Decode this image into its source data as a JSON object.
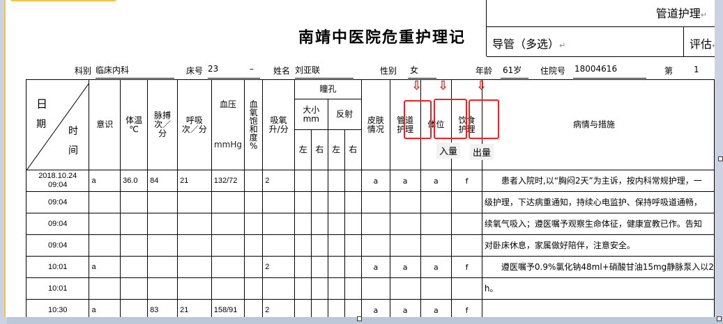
{
  "title": "南靖中医院危重护理记",
  "info": {
    "dept_label": "科别",
    "dept": "临床内科",
    "bed_label": "床号",
    "bed": "23",
    "bed_dash": "–",
    "name_label": "姓名",
    "name": "刘亚联",
    "sex_label": "性别",
    "sex": "女",
    "age_label": "年龄",
    "age": "61岁",
    "adm_label": "住院号",
    "adm": "18004616",
    "page_label": "第",
    "page": "1"
  },
  "headers": {
    "date": "日",
    "date2": "期",
    "time": "时",
    "time2": "间",
    "consc": "意识",
    "temp": "体温\n℃",
    "pulse": "脉搏\n次／\n分",
    "resp": "呼吸\n次／分",
    "bp": "血压",
    "bp_unit": "mmHg",
    "spo2": "血\n氧\n饱\n和\n度\n%",
    "oxy": "吸氧\n升/分",
    "pupil": "瞳孔",
    "size": "大小\nmm",
    "reflex": "反射",
    "left": "左",
    "right": "右",
    "skin": "皮肤\n情况",
    "tube": "管道\n护理",
    "pos": "体位",
    "diet": "饮食\n护理",
    "notes": "病情与措施",
    "intake": "入量",
    "output": "出量"
  },
  "rows": [
    {
      "time": "2018.10.24\n09:04",
      "consc": "a",
      "temp": "36.0",
      "pulse": "84",
      "resp": "21",
      "bp": "132/72",
      "oxy": "2",
      "skin": "a",
      "tube": "a",
      "pos": "a",
      "diet": "f",
      "note": "　　患者入院时,以“胸闷2天”为主诉，按内科常规护理，一"
    },
    {
      "time": "09:04",
      "note": "级护理，下达病重通知，持续心电监护、保持呼吸道通畅，"
    },
    {
      "time": "09:04",
      "note": "续氧气吸入；遵医嘱予观察生命体征，健康宣教已作。告知"
    },
    {
      "time": "09:04",
      "note": "对卧床休息，家属做好陪伴，注意安全。"
    },
    {
      "time": "10:01",
      "consc": "a",
      "oxy": "2",
      "skin": "a",
      "tube": "a",
      "pos": "a",
      "diet": "f",
      "note": "　　遵医嘱予0.9%氯化钠48ml+硝酸甘油15mg静脉泵入以2"
    },
    {
      "time": "10:01",
      "note": "h。"
    },
    {
      "time": "10:30",
      "consc": "a",
      "pulse": "83",
      "resp": "21",
      "bp": "158/91",
      "oxy": "2",
      "skin": "a",
      "tube": "a",
      "pos": "a",
      "diet": "f",
      "note": ""
    }
  ],
  "panel": {
    "title": "管道护理",
    "tube_multi": "导管（多选）",
    "assess": "评估",
    "mark": "↵"
  },
  "colors": {
    "highlight": "#f02020",
    "accent": "#f6c343"
  }
}
